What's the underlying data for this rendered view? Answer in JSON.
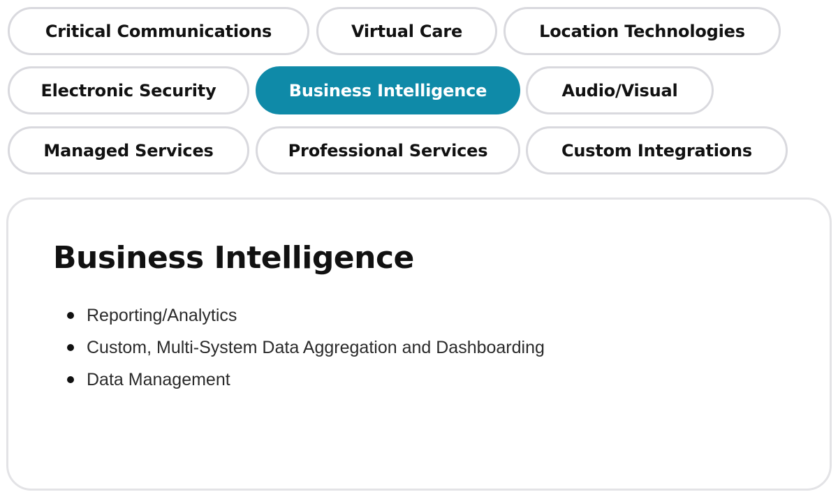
{
  "tabs": [
    {
      "label": "Critical Communications"
    },
    {
      "label": "Virtual Care"
    },
    {
      "label": "Location Technologies"
    },
    {
      "label": "Electronic Security"
    },
    {
      "label": "Business Intelligence"
    },
    {
      "label": "Audio/Visual"
    },
    {
      "label": "Managed Services"
    },
    {
      "label": "Professional Services"
    },
    {
      "label": "Custom Integrations"
    }
  ],
  "active_tab": "Business Intelligence",
  "panel": {
    "title": "Business Intelligence",
    "items": [
      {
        "text": "Reporting/Analytics"
      },
      {
        "text": "Custom, Multi-System Data Aggregation and Dashboarding"
      },
      {
        "text": "Data Management"
      }
    ]
  },
  "colors": {
    "accent": "#0f8aa8",
    "pill_border": "#d9d9de",
    "panel_border": "#e3e3e6"
  }
}
